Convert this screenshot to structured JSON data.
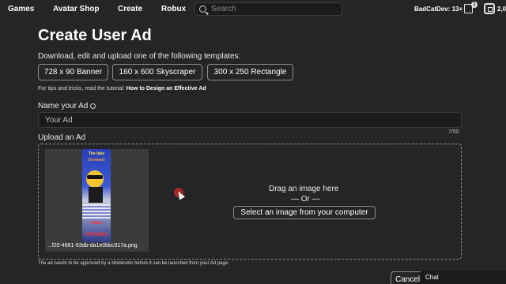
{
  "nav": {
    "games": "Games",
    "avatar_shop": "Avatar Shop",
    "create": "Create",
    "robux": "Robux",
    "search_placeholder": "Search",
    "username": "BadCatDev: 13+",
    "notification_count": "1",
    "robux_amount": "2,0"
  },
  "page": {
    "title": "Create User Ad",
    "subtitle": "Download, edit and upload one of the following templates:",
    "templates": [
      "728 x 90 Banner",
      "160 x 600 Skyscraper",
      "300 x 250 Rectangle"
    ],
    "tips_prefix": "For tips and tricks, read the tutorial:",
    "tips_link": "How to Design an Effective Ad",
    "name_label": "Name your Ad",
    "name_placeholder": "Your Ad",
    "char_counter": "7/50",
    "upload_label": "Upload an Ad",
    "upload_filename": "...f20-4661-93db-da1e0bbc917a.png",
    "drag_text": "Drag an image here",
    "or_text": "— Or —",
    "select_button": "Select an image from your computer",
    "approval_note": "The ad needs to be approved by a Moderator before it can be launched from your Ad page.",
    "cancel_button": "Cancel",
    "chat_label": "Chat"
  },
  "thumbnail_text": {
    "top": "The fake",
    "top2": "Germanz",
    "mid": "8 Fake",
    "bottom": "NOTHING"
  },
  "colors": {
    "background": "#232527",
    "input_bg": "#191b1d",
    "border": "#8a8c8e"
  }
}
